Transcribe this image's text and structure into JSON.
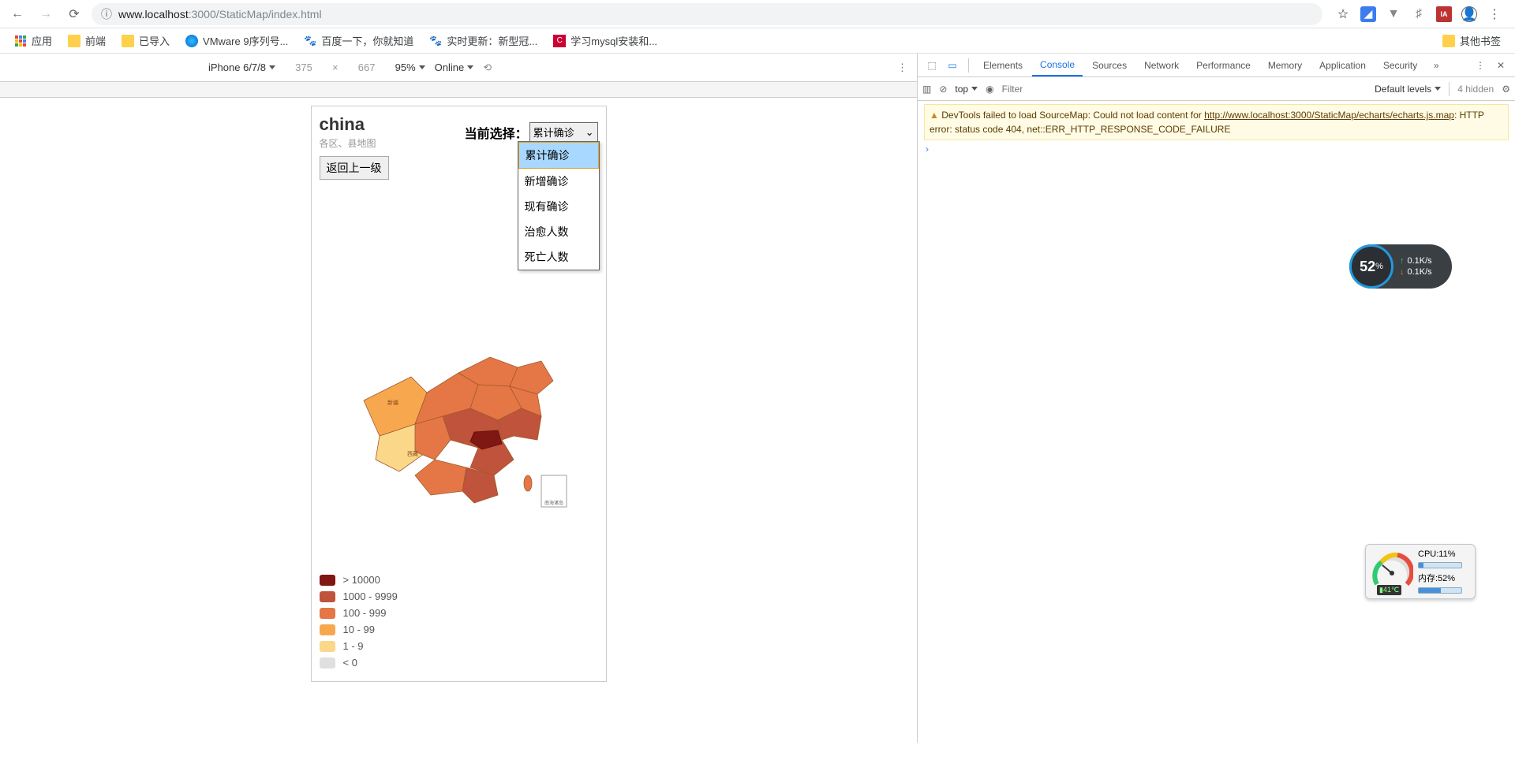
{
  "browser": {
    "url_protocol": "ⓘ",
    "url_host": "www.localhost",
    "url_port": ":3000",
    "url_path": "/StaticMap/index.html"
  },
  "bookmarks": {
    "apps": "应用",
    "items": [
      "前端",
      "已导入",
      "VMware 9序列号...",
      "百度一下，你就知道",
      "实时更新：新型冠...",
      "学习mysql安装和..."
    ],
    "other": "其他书签"
  },
  "device_toolbar": {
    "device": "iPhone 6/7/8",
    "width": "375",
    "height": "667",
    "zoom": "95%",
    "throttle": "Online"
  },
  "app": {
    "title": "china",
    "subtitle": "各区、县地图",
    "back_button": "返回上一级",
    "selector_label": "当前选择：",
    "selector_value": "累计确诊",
    "dropdown_options": [
      "累计确诊",
      "新增确诊",
      "现有确诊",
      "治愈人数",
      "死亡人数"
    ]
  },
  "legend": [
    {
      "color": "#7f1712",
      "label": "> 10000"
    },
    {
      "color": "#c0533b",
      "label": "1000 - 9999"
    },
    {
      "color": "#e57746",
      "label": "100 - 999"
    },
    {
      "color": "#f7a84f",
      "label": "10 - 99"
    },
    {
      "color": "#fbd78a",
      "label": "1 - 9"
    },
    {
      "color": "#e0e0e0",
      "label": "< 0"
    }
  ],
  "chart_data": {
    "type": "map",
    "region": "china",
    "metric": "累计确诊",
    "scale": [
      {
        "min": 10000,
        "max": null,
        "color": "#7f1712"
      },
      {
        "min": 1000,
        "max": 9999,
        "color": "#c0533b"
      },
      {
        "min": 100,
        "max": 999,
        "color": "#e57746"
      },
      {
        "min": 10,
        "max": 99,
        "color": "#f7a84f"
      },
      {
        "min": 1,
        "max": 9,
        "color": "#fbd78a"
      },
      {
        "min": null,
        "max": 0,
        "color": "#e0e0e0"
      }
    ],
    "note": "Choropleth map of China; Hubei shown in darkest shade (>10000), most eastern/central provinces 100-999, Tibet 10-99/lighter."
  },
  "devtools": {
    "tabs": [
      "Elements",
      "Console",
      "Sources",
      "Network",
      "Performance",
      "Memory",
      "Application",
      "Security"
    ],
    "active_tab": "Console",
    "context": "top",
    "filter_placeholder": "Filter",
    "levels": "Default levels",
    "hidden": "4 hidden",
    "warning_prefix": "DevTools failed to load SourceMap: Could not load content for ",
    "warning_url": "http://www.localhost:3000/StaticMap/echarts/echarts.js.map",
    "warning_suffix": ": HTTP error: status code 404, net::ERR_HTTP_RESPONSE_CODE_FAILURE"
  },
  "widgets": {
    "net_percent": "52",
    "net_up": "0.1K/s",
    "net_down": "0.1K/s",
    "cpu_label": "CPU:11%",
    "mem_label": "内存:52%",
    "temp": "41℃"
  }
}
